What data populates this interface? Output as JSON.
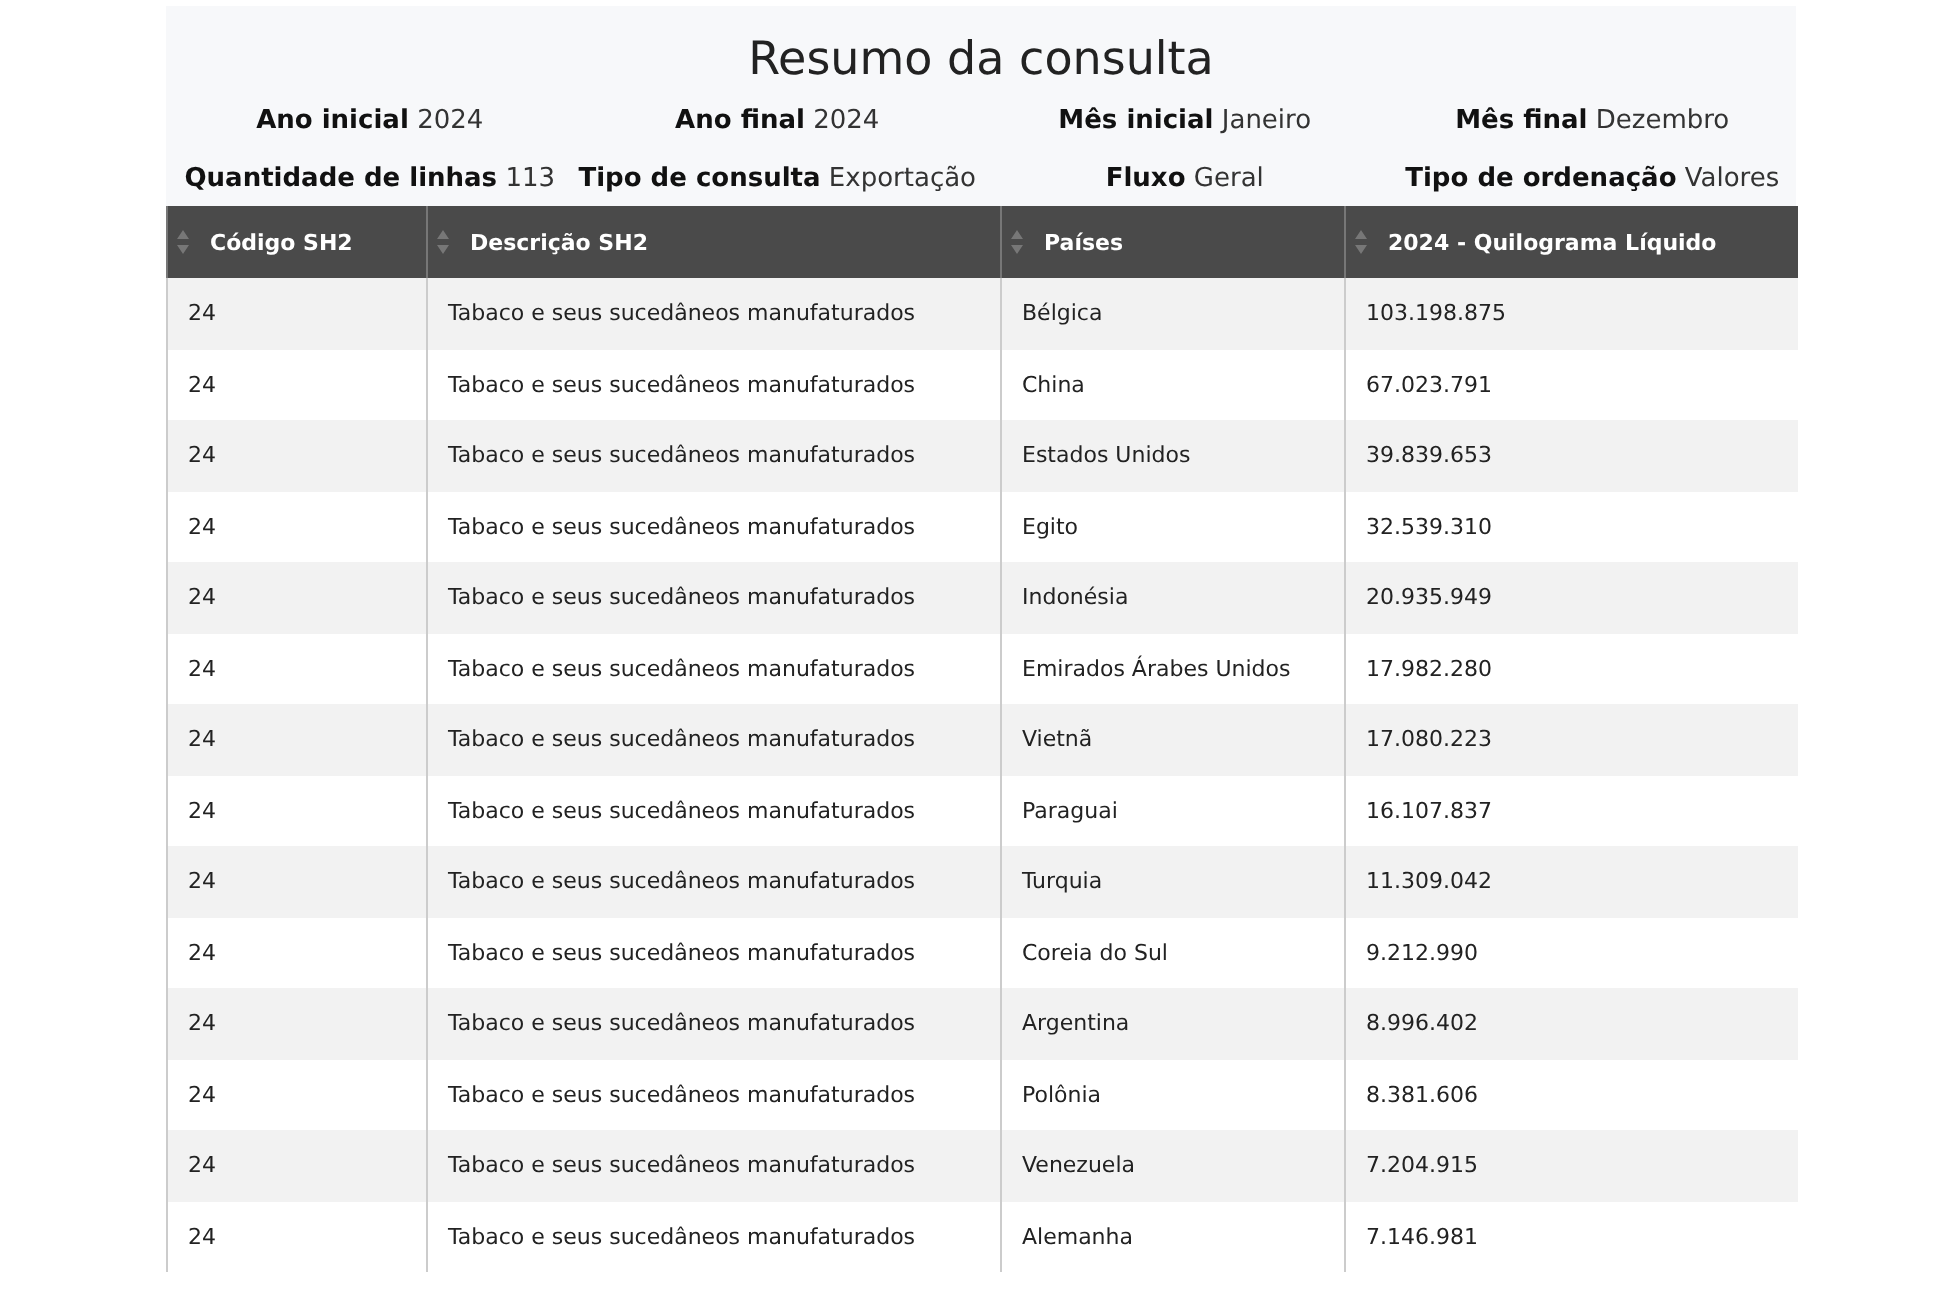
{
  "title": "Resumo da consulta",
  "summary": [
    {
      "label": "Ano inicial",
      "value": "2024"
    },
    {
      "label": "Ano final",
      "value": "2024"
    },
    {
      "label": "Mês inicial",
      "value": "Janeiro"
    },
    {
      "label": "Mês final",
      "value": "Dezembro"
    },
    {
      "label": "Quantidade de linhas",
      "value": "113"
    },
    {
      "label": "Tipo de consulta",
      "value": "Exportação"
    },
    {
      "label": "Fluxo",
      "value": "Geral"
    },
    {
      "label": "Tipo de ordenação",
      "value": "Valores"
    }
  ],
  "table": {
    "columns": [
      "Código SH2",
      "Descrição SH2",
      "Países",
      "2024 - Quilograma Líquido"
    ],
    "rows": [
      [
        "24",
        "Tabaco e seus sucedâneos manufaturados",
        "Bélgica",
        "103.198.875"
      ],
      [
        "24",
        "Tabaco e seus sucedâneos manufaturados",
        "China",
        "67.023.791"
      ],
      [
        "24",
        "Tabaco e seus sucedâneos manufaturados",
        "Estados Unidos",
        "39.839.653"
      ],
      [
        "24",
        "Tabaco e seus sucedâneos manufaturados",
        "Egito",
        "32.539.310"
      ],
      [
        "24",
        "Tabaco e seus sucedâneos manufaturados",
        "Indonésia",
        "20.935.949"
      ],
      [
        "24",
        "Tabaco e seus sucedâneos manufaturados",
        "Emirados Árabes Unidos",
        "17.982.280"
      ],
      [
        "24",
        "Tabaco e seus sucedâneos manufaturados",
        "Vietnã",
        "17.080.223"
      ],
      [
        "24",
        "Tabaco e seus sucedâneos manufaturados",
        "Paraguai",
        "16.107.837"
      ],
      [
        "24",
        "Tabaco e seus sucedâneos manufaturados",
        "Turquia",
        "11.309.042"
      ],
      [
        "24",
        "Tabaco e seus sucedâneos manufaturados",
        "Coreia do Sul",
        "9.212.990"
      ],
      [
        "24",
        "Tabaco e seus sucedâneos manufaturados",
        "Argentina",
        "8.996.402"
      ],
      [
        "24",
        "Tabaco e seus sucedâneos manufaturados",
        "Polônia",
        "8.381.606"
      ],
      [
        "24",
        "Tabaco e seus sucedâneos manufaturados",
        "Venezuela",
        "7.204.915"
      ],
      [
        "24",
        "Tabaco e seus sucedâneos manufaturados",
        "Alemanha",
        "7.146.981"
      ]
    ]
  }
}
